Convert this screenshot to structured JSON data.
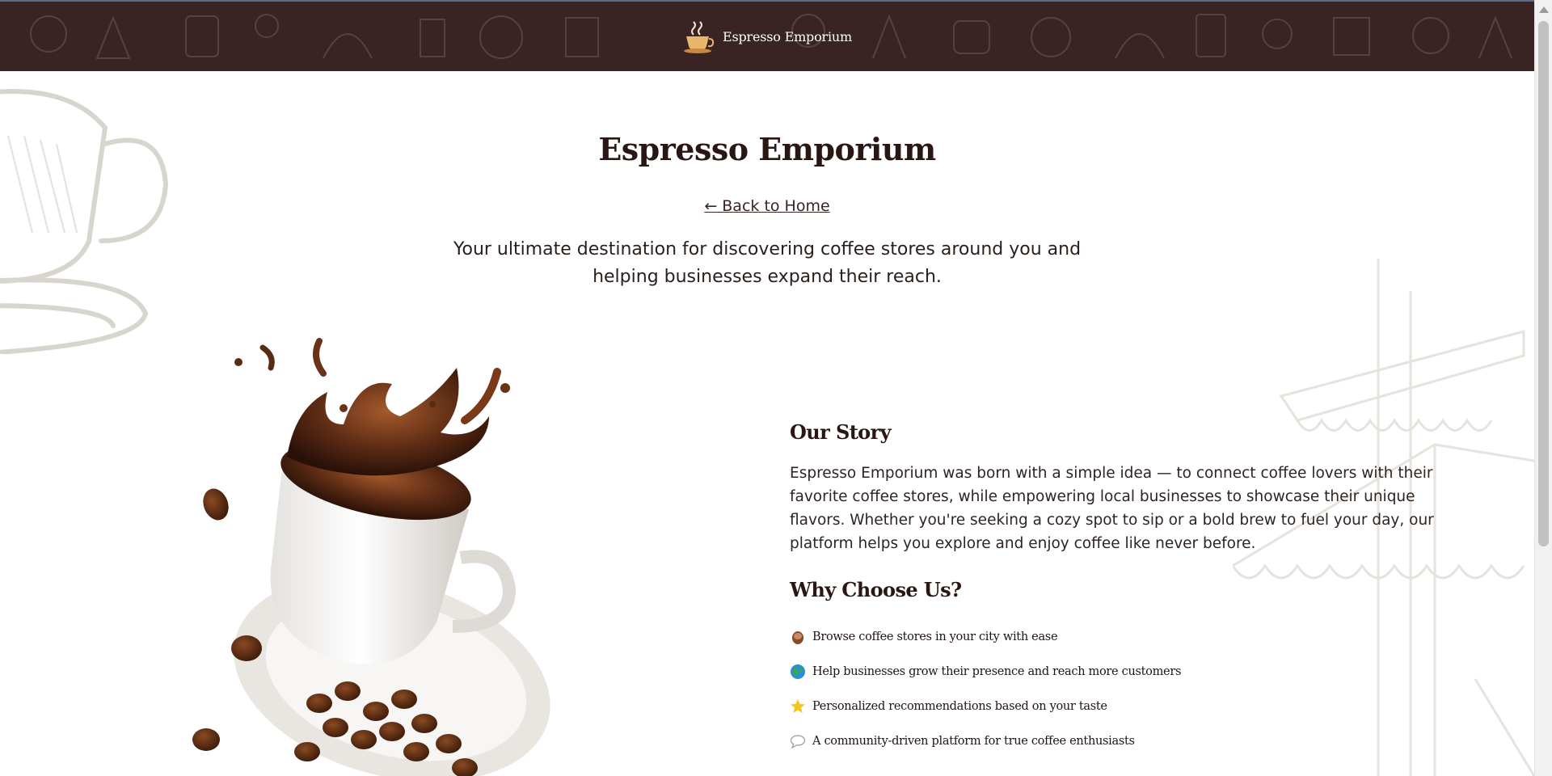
{
  "header": {
    "brand_name": "Espresso Emporium",
    "logo_icon": "coffee-cup-logo-icon"
  },
  "hero": {
    "title": "Espresso Emporium",
    "back_link": "← Back to Home",
    "intro": "Your ultimate destination for discovering coffee stores around you and helping businesses expand their reach."
  },
  "story": {
    "heading": "Our Story",
    "text": "Espresso Emporium was born with a simple idea — to connect coffee lovers with their favorite coffee stores, while empowering local businesses to showcase their unique flavors. Whether you're seeking a cozy spot to sip or a bold brew to fuel your day, our platform helps you explore and enjoy coffee like never before."
  },
  "why": {
    "heading": "Why Choose Us?",
    "features": [
      {
        "icon": "coffee-icon",
        "label": "Browse coffee stores in your city with ease"
      },
      {
        "icon": "globe-icon",
        "label": "Help businesses grow their presence and reach more customers"
      },
      {
        "icon": "star-icon",
        "label": "Personalized recommendations based on your taste"
      },
      {
        "icon": "speech-bubble-icon",
        "label": "A community-driven platform for true coffee enthusiasts"
      }
    ]
  },
  "colors": {
    "header_bg": "#3a2423",
    "heading": "#2a1612",
    "text": "#2e2422"
  }
}
